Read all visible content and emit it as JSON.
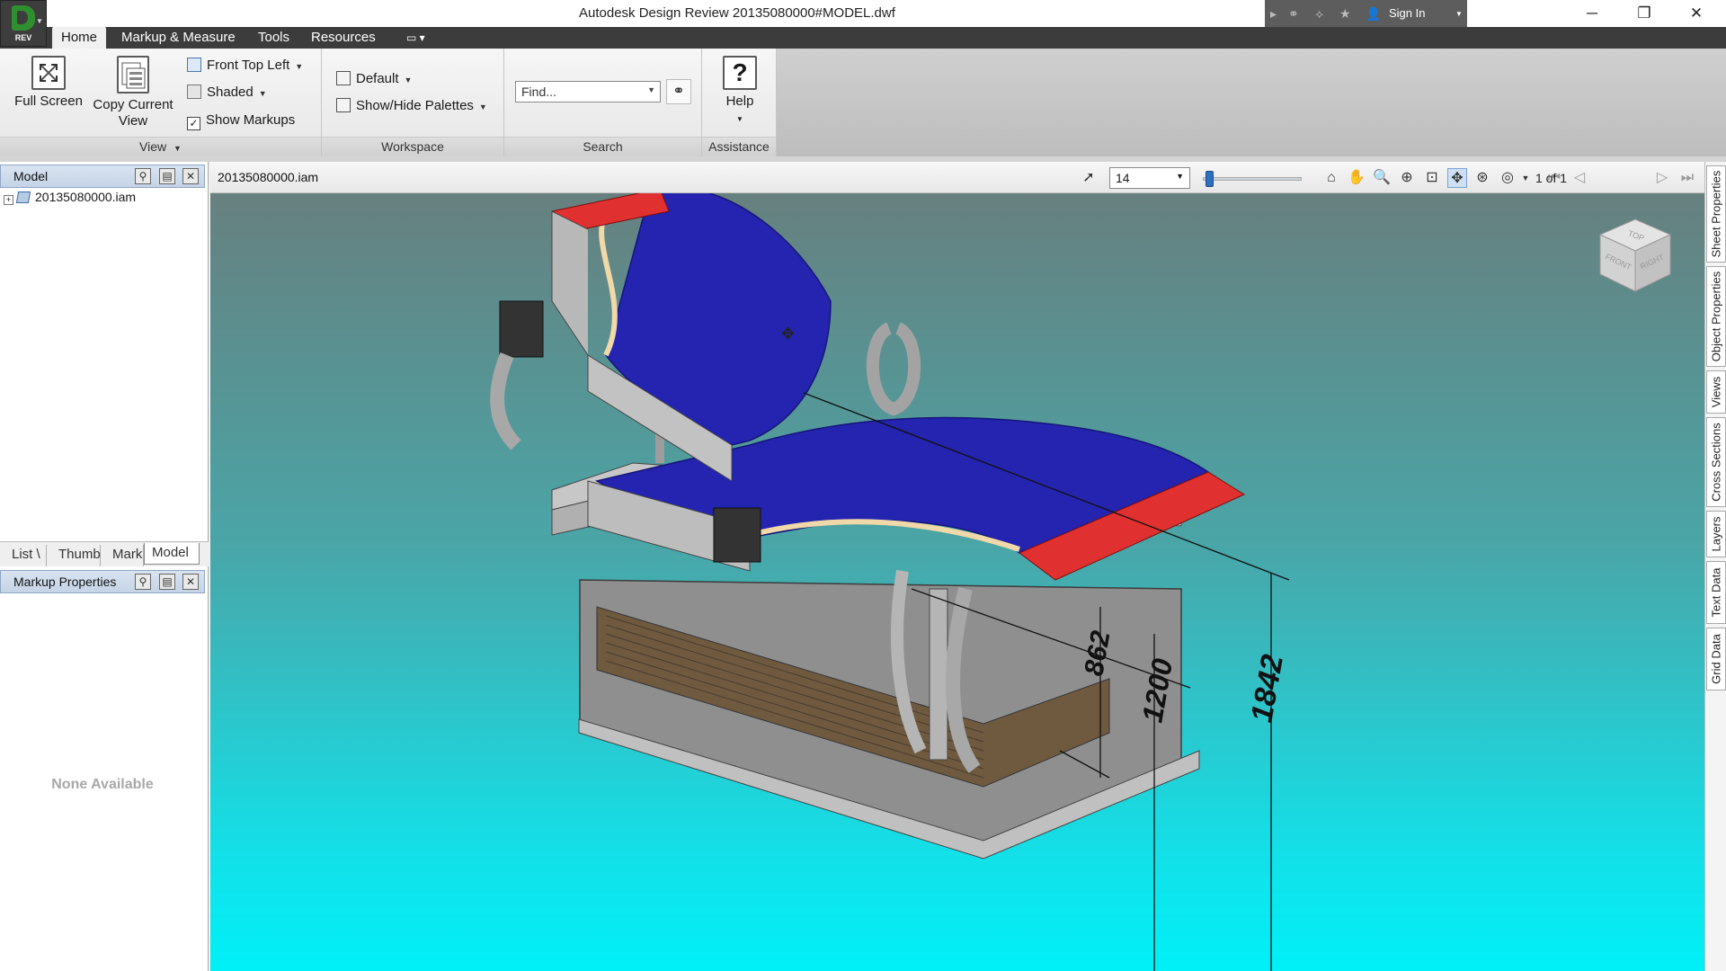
{
  "app": {
    "window_title": "Autodesk Design Review   20135080000#MODEL.dwf",
    "app_badge": "REV",
    "sign_in": "Sign In"
  },
  "menu_tabs": [
    "Home",
    "Markup & Measure",
    "Tools",
    "Resources"
  ],
  "ribbon": {
    "view": {
      "title": "View",
      "full_screen": "Full Screen",
      "copy_current_view_1": "Copy Current",
      "copy_current_view_2": "View",
      "front_top_left": "Front Top Left",
      "shaded": "Shaded",
      "show_markups": "Show Markups"
    },
    "workspace": {
      "title": "Workspace",
      "default": "Default",
      "show_hide_palettes": "Show/Hide Palettes"
    },
    "search": {
      "title": "Search",
      "placeholder": "Find..."
    },
    "assistance": {
      "title": "Assistance",
      "help": "Help"
    }
  },
  "left_panel": {
    "model_title": "Model",
    "tree_item": "20135080000.iam",
    "tabs": [
      "List \\",
      "Thumb",
      "Mark",
      "Model"
    ],
    "markup_properties_title": "Markup Properties",
    "none_available": "None Available"
  },
  "canvas": {
    "document_name": "20135080000.iam",
    "zoom_value": "14",
    "slider_fraction": 0.02,
    "page_indicator": "1 of 1"
  },
  "model_dimensions": [
    "862",
    "1200",
    "1842"
  ],
  "viewcube": {
    "top": "TOP",
    "front": "FRONT",
    "right": "RIGHT"
  },
  "right_tabs": [
    "Sheet Properties",
    "Object Properties",
    "Views",
    "Cross Sections",
    "Layers",
    "Text Data",
    "Grid Data"
  ],
  "colors": {
    "conveyor_blue": "#2424b0",
    "conveyor_red": "#e03030",
    "frame_gray": "#b4b4b4",
    "background_top": "#67807f",
    "background_bottom": "#00f0f8"
  }
}
